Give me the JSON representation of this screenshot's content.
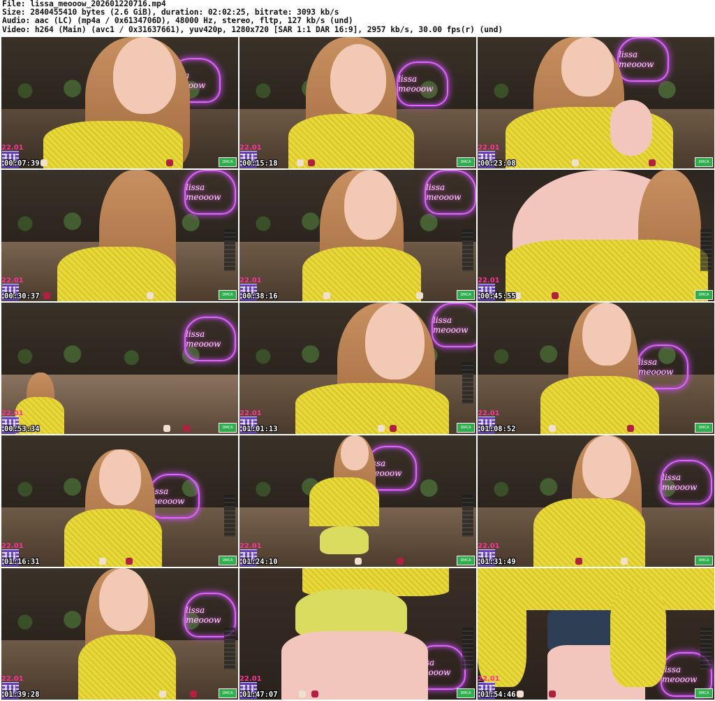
{
  "header": {
    "file": "File: lissa_meooow_202601220716.mp4",
    "size": "Size: 2840455410 bytes (2.6 GiB), duration: 02:02:25, bitrate: 3093 kb/s",
    "audio": "Audio: aac (LC) (mp4a / 0x6134706D), 48000 Hz, stereo, fltp, 127 kb/s (und)",
    "video": "Video: h264 (Main) (avc1 / 0x31637661), yuv420p, 1280x720 [SAR 1:1 DAR 16:9], 2957 kb/s, 30.00 fps(r) (und)"
  },
  "overlay_date": "22.01",
  "dmca_label": "DMCA",
  "neon_text": "lissa meooow",
  "colors": {
    "neon": "#e066ff",
    "sweater": "#e8d83a",
    "timestamp": "#ffffff",
    "dmca": "#2fae4e"
  },
  "thumbnails": [
    {
      "timestamp": "00:07:39"
    },
    {
      "timestamp": "00:15:18"
    },
    {
      "timestamp": "00:23:08"
    },
    {
      "timestamp": "00:30:37"
    },
    {
      "timestamp": "00:38:16"
    },
    {
      "timestamp": "00:45:55"
    },
    {
      "timestamp": "00:53:34"
    },
    {
      "timestamp": "01:01:13"
    },
    {
      "timestamp": "01:08:52"
    },
    {
      "timestamp": "01:16:31"
    },
    {
      "timestamp": "01:24:10"
    },
    {
      "timestamp": "01:31:49"
    },
    {
      "timestamp": "01:39:28"
    },
    {
      "timestamp": "01:47:07"
    },
    {
      "timestamp": "01:54:46"
    }
  ]
}
